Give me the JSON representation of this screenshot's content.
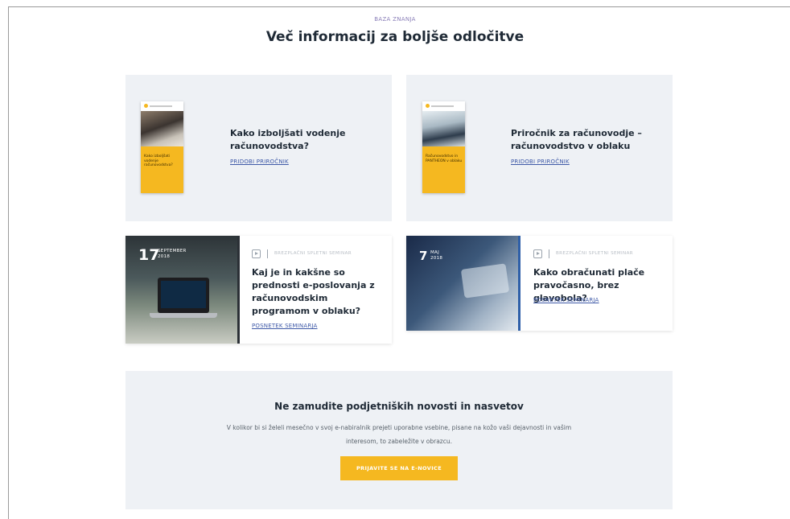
{
  "header": {
    "eyebrow": "BAZA ZNANJA",
    "title": "Več informacij za boljše odločitve"
  },
  "handbooks": [
    {
      "title": "Kako izboljšati vodenje računovodstva?",
      "link": "PRIDOBI PRIROČNIK",
      "cover_text": "Kako izboljšati vodenje računovodstva?"
    },
    {
      "title": "Priročnik za računovodje – računovodstvo v oblaku",
      "link": "PRIDOBI PRIROČNIK",
      "cover_text": "Računovodstvo in PANTHEON v oblaku"
    }
  ],
  "seminars": [
    {
      "day": "17",
      "month": "SEPTEMBER",
      "year": "2018",
      "category": "BREZPLAČNI SPLETNI SEMINAR",
      "title": "Kaj je in kakšne so prednosti e-poslovanja z računovodskim programom v oblaku?",
      "link": "POSNETEK SEMINARJA"
    },
    {
      "day": "7",
      "month": "MAJ",
      "year": "2018",
      "category": "BREZPLAČNI SPLETNI SEMINAR",
      "title": "Kako obračunati plače pravočasno, brez glavobola?",
      "link": "POSNETEK SEMINARJA"
    }
  ],
  "newsletter": {
    "title": "Ne zamudite podjetniških novosti in nasvetov",
    "text": "V kolikor bi si želeli mesečno v svoj e-nabiralnik prejeti uporabne vsebine, pisane na kožo vaši dejavnosti in vašim interesom, to zabeležite v obrazcu.",
    "button": "PRIJAVITE SE NA E-NOVICE"
  },
  "colors": {
    "accent": "#f5b820",
    "link": "#3f5aa8",
    "card_bg": "#eef1f5"
  }
}
